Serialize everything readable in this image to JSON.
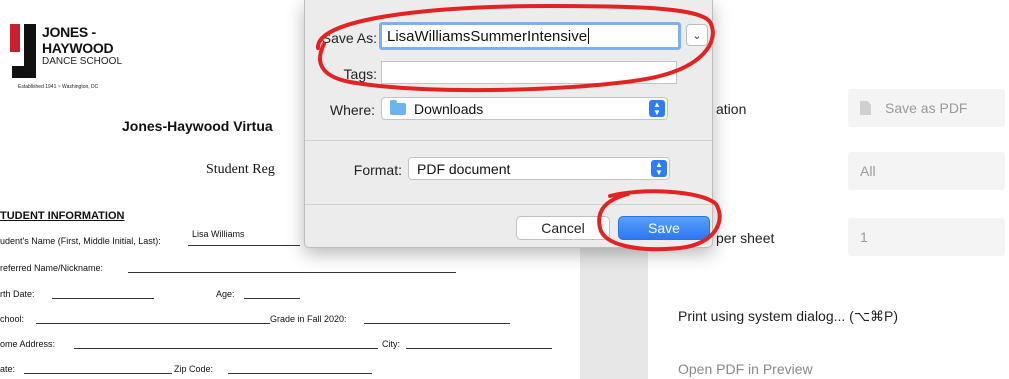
{
  "document": {
    "logo_line1": "JONES -",
    "logo_line2": "HAYWOOD",
    "logo_line3": "DANCE SCHOOL",
    "logo_established": "Established 1941 ~ Washington, DC",
    "title": "Jones-Haywood Virtua",
    "subtitle": "Student Reg",
    "section": "TUDENT INFORMATION",
    "fields": {
      "name_label": "udent's Name (First, Middle Initial, Last):",
      "name_value": "Lisa Williams",
      "nickname_label": "referred Name/Nickname:",
      "birth_label": "rth Date:",
      "age_label": "Age:",
      "school_label": "chool:",
      "grade_label": "Grade in Fall 2020:",
      "address_label": "ome Address:",
      "city_label": "City:",
      "state_label": "ate:",
      "zip_label": "Zip Code:"
    }
  },
  "print_panel": {
    "destination_label": "ation",
    "destination_value": "Save as PDF",
    "pages_value": "All",
    "pages_per_sheet_label": "per sheet",
    "pages_per_sheet_value": "1",
    "system_dialog_link": "Print using system dialog... (⌥⌘P)",
    "open_preview_link": "Open PDF in Preview"
  },
  "save_dialog": {
    "save_as_label": "Save As:",
    "save_as_value": "LisaWilliamsSummerIntensive",
    "tags_label": "Tags:",
    "tags_value": "",
    "where_label": "Where:",
    "where_value": "Downloads",
    "format_label": "Format:",
    "format_value": "PDF document",
    "cancel_label": "Cancel",
    "save_label": "Save"
  },
  "colors": {
    "annotation_red": "#e32222",
    "accent_blue": "#2f7cf6",
    "logo_red": "#c8202e"
  },
  "icons": [
    "expand-chevron-icon",
    "folder-icon",
    "stepper-icon",
    "document-icon"
  ]
}
